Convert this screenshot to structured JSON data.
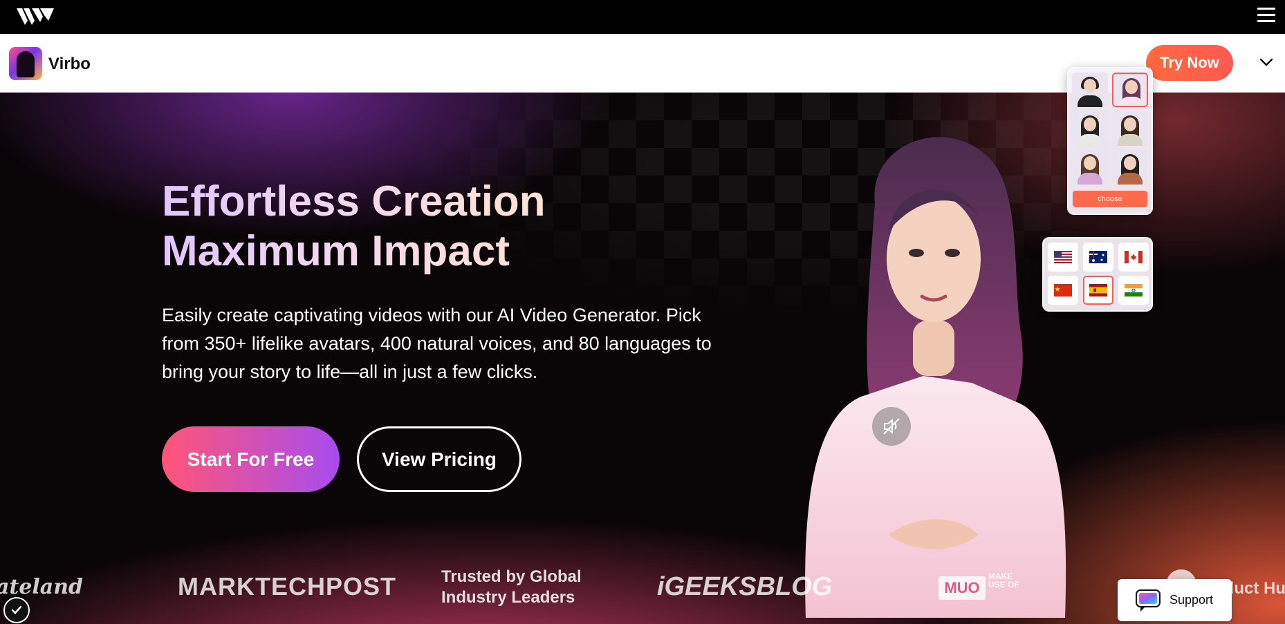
{
  "topbar": {
    "logo_icon": "wondershare-logo",
    "menu_icon": "hamburger-menu-icon"
  },
  "navbar": {
    "app_name": "Virbo",
    "app_icon": "virbo-logo",
    "try_label": "Try Now",
    "expand_icon": "chevron-down-icon"
  },
  "hero": {
    "title_line1": "Effortless Creation",
    "title_line2": "Maximum Impact",
    "description": "Easily create captivating videos with our AI Video Generator. Pick from 350+ lifelike avatars, 400 natural voices, and 80 languages to bring your story to life—all in just a few clicks.",
    "start_label": "Start For Free",
    "pricing_label": "View Pricing",
    "mute_icon": "speaker-muted-icon"
  },
  "avatar_picker": {
    "choose_label": "choose",
    "selected_index": 1
  },
  "flag_picker": {
    "flags": [
      "us-flag",
      "australia-flag",
      "canada-flag",
      "china-flag",
      "spain-flag",
      "india-flag"
    ],
    "selected_index": 4
  },
  "logos": {
    "gateland": "ateland",
    "marktechpost": "MARKTECHPOST",
    "trusted_line1": "Trusted by Global",
    "trusted_line2": "Industry Leaders",
    "igeeksblog": "iGEEKSBLOG",
    "muo_box": "MUO",
    "muo_side": "MAKE USE OF",
    "product_hunt": "oduct Hu"
  },
  "support": {
    "label": "Support",
    "icon": "chat-bubble-icon"
  },
  "badge": {
    "icon": "shield-check-icon"
  },
  "colors": {
    "accent": "#ff5a52",
    "gradient_start": "#ff5577",
    "gradient_end": "#a84cf0"
  }
}
